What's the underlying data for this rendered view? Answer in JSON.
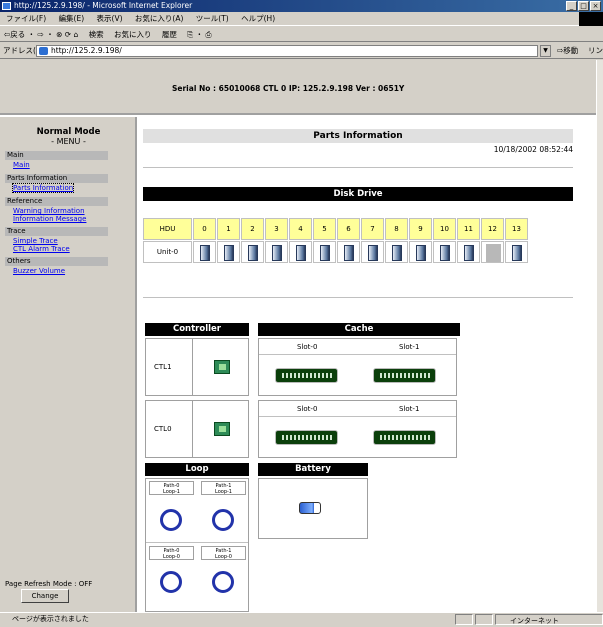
{
  "window": {
    "title": "http://125.2.9.198/ - Microsoft Internet Explorer"
  },
  "menubar": [
    "ファイル(F)",
    "編集(E)",
    "表示(V)",
    "お気に入り(A)",
    "ツール(T)",
    "ヘルプ(H)"
  ],
  "toolbar": [
    "⇦戻る ・ ⇨ ・ ⊗ ⟳ ⌂",
    "検索",
    "お気に入り",
    "履歴",
    "⎘ ・ ⎙"
  ],
  "address": {
    "label": "アドレス(D)",
    "url": "http://125.2.9.198/",
    "go": "⇨移動",
    "links": "リンク »"
  },
  "header": {
    "serial_line": "Serial No : 65010068  CTL 0  IP: 125.2.9.198  Ver : 0651Y"
  },
  "sidebar": {
    "mode_title": "Normal Mode",
    "menu_label": "- MENU -",
    "sections": [
      {
        "label": "Main",
        "links": [
          "Main"
        ]
      },
      {
        "label": "Parts Information",
        "links": [
          "Parts Information"
        ]
      },
      {
        "label": "Reference",
        "links": [
          "Warning Information",
          "Information Message"
        ]
      },
      {
        "label": "Trace",
        "links": [
          "Simple Trace",
          "CTL Alarm Trace"
        ]
      },
      {
        "label": "Others",
        "links": [
          "Buzzer Volume"
        ]
      }
    ],
    "refresh_label": "Page Refresh Mode : OFF",
    "change_button": "Change"
  },
  "main": {
    "title": "Parts Information",
    "datetime": "10/18/2002 08:52:44",
    "disk": {
      "header": "Disk Drive",
      "hdu_label": "HDU",
      "columns": [
        "0",
        "1",
        "2",
        "3",
        "4",
        "5",
        "6",
        "7",
        "8",
        "9",
        "10",
        "11",
        "12",
        "13"
      ],
      "unit_label": "Unit-0",
      "empty_slots": [
        12
      ]
    },
    "controller": {
      "header": "Controller",
      "labels": [
        "CTL1",
        "CTL0"
      ]
    },
    "cache": {
      "header": "Cache",
      "slots": [
        "Slot-0",
        "Slot-1"
      ]
    },
    "loop": {
      "header": "Loop",
      "labels": [
        "Path-0\nLoop-1",
        "Path-1\nLoop-1",
        "Path-0\nLoop-0",
        "Path-1\nLoop-0"
      ]
    },
    "battery": {
      "header": "Battery"
    }
  },
  "status": {
    "text": "ページが表示されました",
    "zone": "インターネット"
  }
}
